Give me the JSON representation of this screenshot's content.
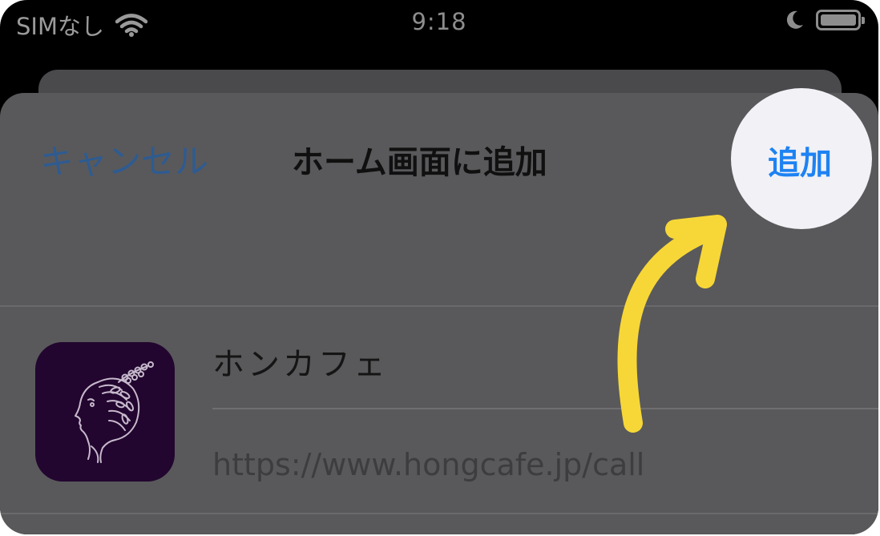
{
  "status_bar": {
    "carrier": "SIMなし",
    "time": "9:18"
  },
  "sheet": {
    "cancel_label": "キャンセル",
    "title": "ホーム画面に追加",
    "add_label": "追加"
  },
  "bookmark": {
    "name": "ホンカフェ",
    "url": "https://www.hongcafe.jp/call"
  },
  "colors": {
    "cancel": "#2e5b91",
    "add": "#1e82f2",
    "annotation_arrow": "#f7d737",
    "app_icon_bg": "#22062f"
  },
  "icons": [
    "wifi-icon",
    "moon-icon",
    "battery-icon",
    "app-icon-woman-with-wreath",
    "annotation-arrow"
  ]
}
